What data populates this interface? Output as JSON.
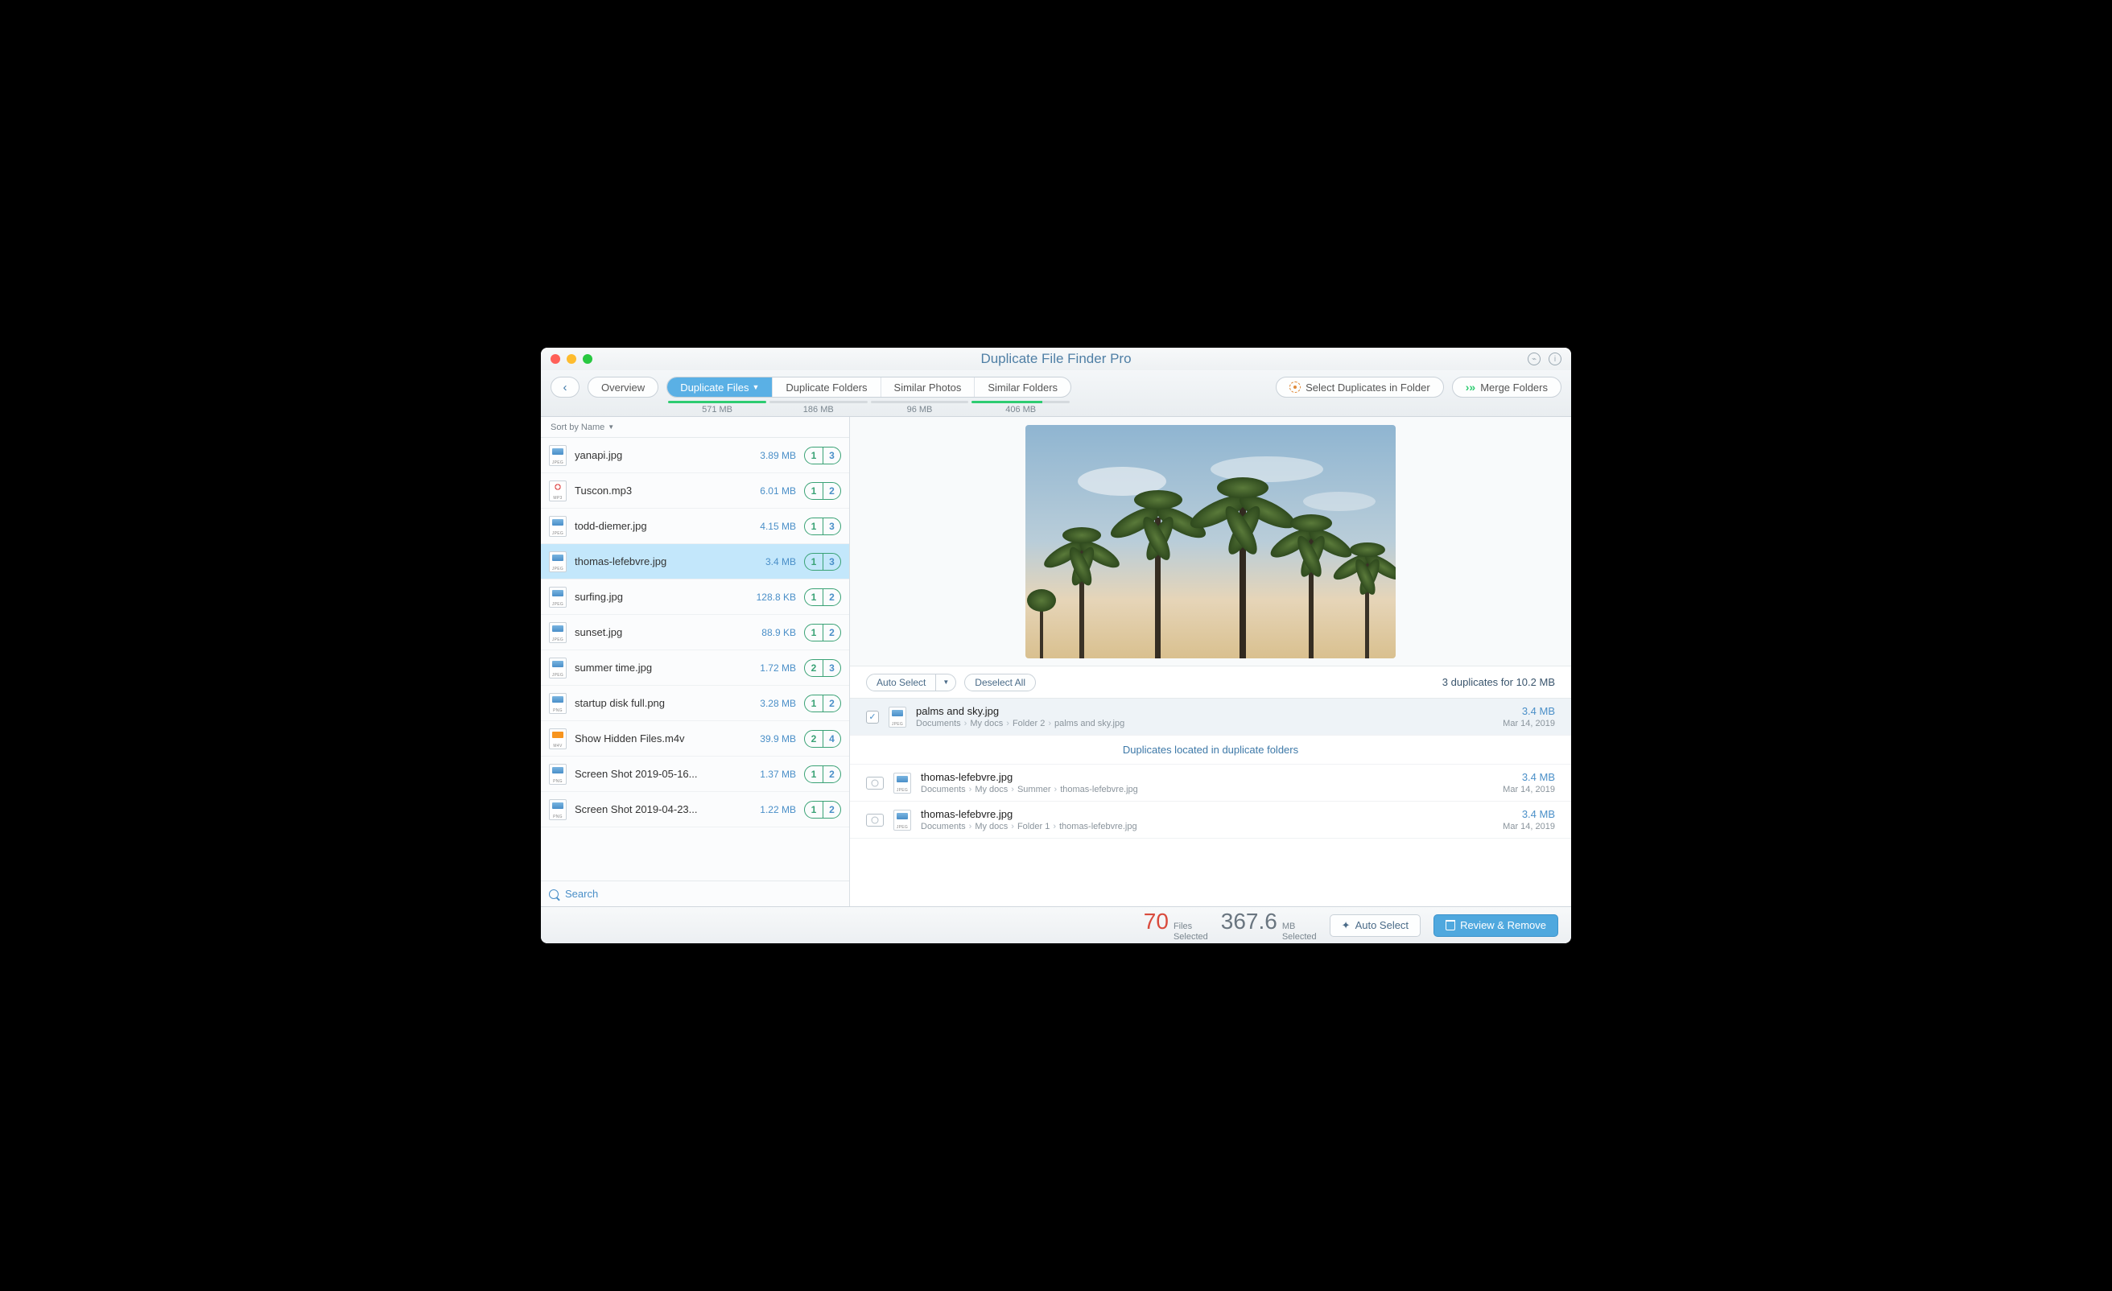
{
  "title": "Duplicate File Finder Pro",
  "toolbar": {
    "overview": "Overview",
    "tabs": [
      {
        "label": "Duplicate Files",
        "size": "571 MB",
        "fill": 100,
        "active": true,
        "dropdown": true
      },
      {
        "label": "Duplicate Folders",
        "size": "186 MB",
        "fill": 0
      },
      {
        "label": "Similar Photos",
        "size": "96 MB",
        "fill": 0
      },
      {
        "label": "Similar Folders",
        "size": "406 MB",
        "fill": 72
      }
    ],
    "select_dup": "Select Duplicates in Folder",
    "merge": "Merge Folders"
  },
  "sidebar": {
    "sort_label": "Sort by Name",
    "search_placeholder": "Search",
    "files": [
      {
        "name": "yanapi.jpg",
        "size": "3.89 MB",
        "b1": "1",
        "b2": "3",
        "ext": "JPEG"
      },
      {
        "name": "Tuscon.mp3",
        "size": "6.01 MB",
        "b1": "1",
        "b2": "2",
        "ext": "MP3",
        "kind": "mp3"
      },
      {
        "name": "todd-diemer.jpg",
        "size": "4.15 MB",
        "b1": "1",
        "b2": "3",
        "ext": "JPEG"
      },
      {
        "name": "thomas-lefebvre.jpg",
        "size": "3.4 MB",
        "b1": "1",
        "b2": "3",
        "ext": "JPEG",
        "selected": true
      },
      {
        "name": "surfing.jpg",
        "size": "128.8 KB",
        "b1": "1",
        "b2": "2",
        "ext": "JPEG"
      },
      {
        "name": "sunset.jpg",
        "size": "88.9 KB",
        "b1": "1",
        "b2": "2",
        "ext": "JPEG"
      },
      {
        "name": "summer time.jpg",
        "size": "1.72 MB",
        "b1": "2",
        "b2": "3",
        "ext": "JPEG"
      },
      {
        "name": "startup disk full.png",
        "size": "3.28 MB",
        "b1": "1",
        "b2": "2",
        "ext": "PNG"
      },
      {
        "name": "Show Hidden Files.m4v",
        "size": "39.9 MB",
        "b1": "2",
        "b2": "4",
        "ext": "M4V",
        "kind": "m4v"
      },
      {
        "name": "Screen Shot 2019-05-16...",
        "size": "1.37 MB",
        "b1": "1",
        "b2": "2",
        "ext": "PNG"
      },
      {
        "name": "Screen Shot 2019-04-23...",
        "size": "1.22 MB",
        "b1": "1",
        "b2": "2",
        "ext": "PNG"
      }
    ]
  },
  "detail": {
    "auto_select": "Auto Select",
    "deselect": "Deselect All",
    "summary": "3 duplicates for 10.2 MB",
    "primary": {
      "name": "palms and sky.jpg",
      "path": [
        "Documents",
        "My docs",
        "Folder 2",
        "palms and sky.jpg"
      ],
      "size": "3.4 MB",
      "date": "Mar 14, 2019",
      "checked": true
    },
    "section": "Duplicates located in duplicate folders",
    "dups": [
      {
        "name": "thomas-lefebvre.jpg",
        "path": [
          "Documents",
          "My docs",
          "Summer",
          "thomas-lefebvre.jpg"
        ],
        "size": "3.4 MB",
        "date": "Mar 14, 2019"
      },
      {
        "name": "thomas-lefebvre.jpg",
        "path": [
          "Documents",
          "My docs",
          "Folder 1",
          "thomas-lefebvre.jpg"
        ],
        "size": "3.4 MB",
        "date": "Mar 14, 2019"
      }
    ]
  },
  "footer": {
    "files_count": "70",
    "files_label_a": "Files",
    "files_label_b": "Selected",
    "mb_count": "367.6",
    "mb_label_a": "MB",
    "mb_label_b": "Selected",
    "auto_select": "Auto Select",
    "review": "Review & Remove"
  }
}
